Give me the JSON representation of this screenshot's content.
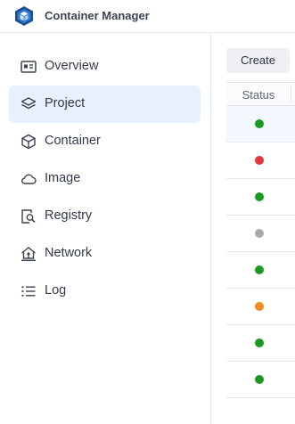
{
  "app": {
    "title": "Container Manager",
    "logo_icon": "container-manager-logo"
  },
  "sidebar": {
    "items": [
      {
        "label": "Overview",
        "icon": "overview-icon",
        "active": false
      },
      {
        "label": "Project",
        "icon": "layers-icon",
        "active": true
      },
      {
        "label": "Container",
        "icon": "cube-icon",
        "active": false
      },
      {
        "label": "Image",
        "icon": "cloud-icon",
        "active": false
      },
      {
        "label": "Registry",
        "icon": "registry-search-icon",
        "active": false
      },
      {
        "label": "Network",
        "icon": "network-house-icon",
        "active": false
      },
      {
        "label": "Log",
        "icon": "list-icon",
        "active": false
      }
    ]
  },
  "main": {
    "create_label": "Create",
    "table": {
      "columns": [
        "Status"
      ],
      "rows": [
        {
          "status": "running",
          "color": "#1a9a22",
          "selected": true
        },
        {
          "status": "error",
          "color": "#e0393e",
          "selected": false
        },
        {
          "status": "running",
          "color": "#1a9a22",
          "selected": false
        },
        {
          "status": "stopped",
          "color": "#a9abb0",
          "selected": false
        },
        {
          "status": "running",
          "color": "#1a9a22",
          "selected": false
        },
        {
          "status": "warning",
          "color": "#ef8b1f",
          "selected": false
        },
        {
          "status": "running",
          "color": "#1a9a22",
          "selected": false
        },
        {
          "status": "running",
          "color": "#1a9a22",
          "selected": false
        }
      ]
    }
  },
  "colors": {
    "accent": "#1f6fd1",
    "active_nav_bg": "#e6f1fc"
  }
}
